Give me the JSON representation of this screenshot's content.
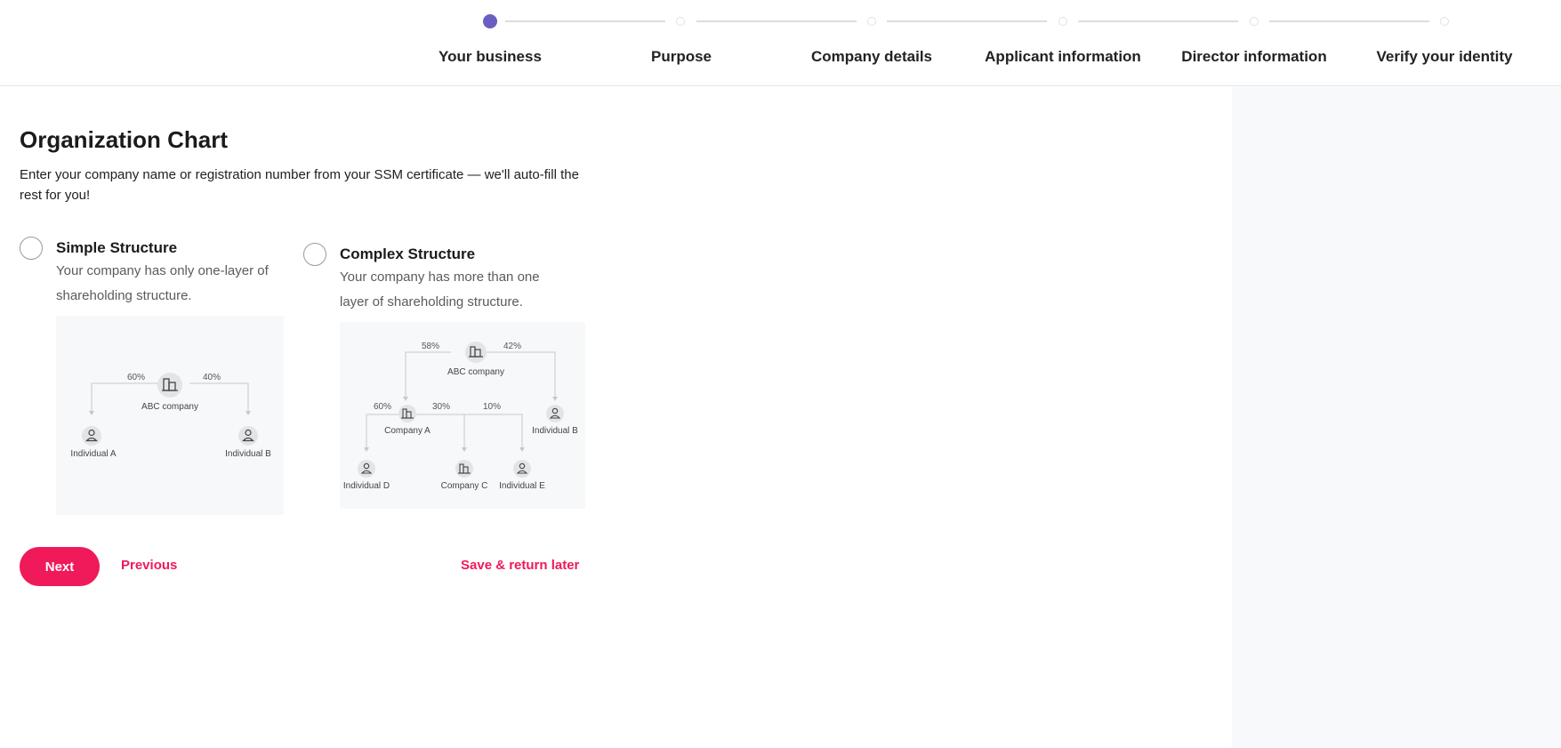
{
  "stepper": {
    "steps": [
      {
        "label": "Your business",
        "active": true
      },
      {
        "label": "Purpose",
        "active": false
      },
      {
        "label": "Company details",
        "active": false
      },
      {
        "label": "Applicant information",
        "active": false
      },
      {
        "label": "Director information",
        "active": false
      },
      {
        "label": "Verify your identity",
        "active": false
      }
    ]
  },
  "main": {
    "title": "Organization Chart",
    "subtitle": "Enter your company name or registration number from your SSM certificate — we'll auto-fill the rest for you!"
  },
  "options": {
    "simple": {
      "title": "Simple Structure",
      "desc": "Your company has only one-layer of shareholding structure.",
      "diagram": {
        "company": "ABC company",
        "left_pct": "60%",
        "right_pct": "40%",
        "left_node": "Individual A",
        "right_node": "Individual B"
      }
    },
    "complex": {
      "title": "Complex Structure",
      "desc": "Your company has more than one layer of shareholding structure.",
      "diagram": {
        "company": "ABC company",
        "top_left_pct": "58%",
        "top_right_pct": "42%",
        "company_a": "Company A",
        "individual_b": "Individual B",
        "pct_d": "60%",
        "pct_c": "30%",
        "pct_e": "10%",
        "individual_d": "Individual D",
        "company_c": "Company C",
        "individual_e": "Individual E"
      }
    }
  },
  "actions": {
    "next": "Next",
    "previous": "Previous",
    "save": "Save & return later"
  },
  "colors": {
    "accent": "#f0195a",
    "step_active": "#6a5fc1"
  }
}
